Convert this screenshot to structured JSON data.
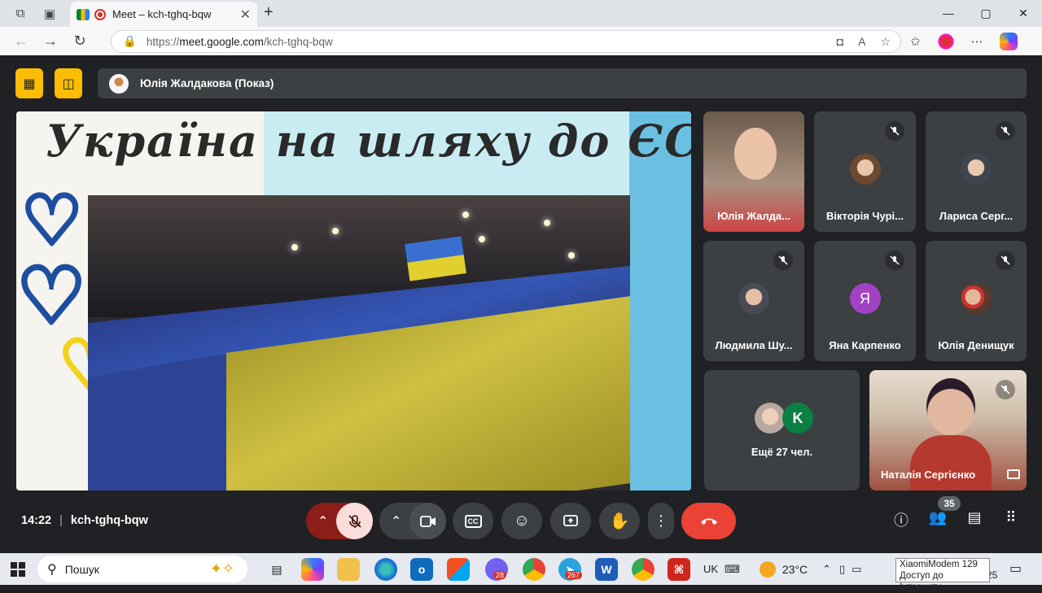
{
  "browser": {
    "tab_title": "Meet – kch-tghq-bqw",
    "new_tab_icon": "+",
    "url_prefix": "https://",
    "url_host": "meet.google.com",
    "url_path": "/kch-tghq-bqw",
    "window_controls": [
      "—",
      "▢",
      "✕"
    ]
  },
  "meet": {
    "presenter_bar": "Юлія Жалдакова (Показ)",
    "slide_title": "Україна на шляху до ЄС",
    "tiles": [
      {
        "name": "Юлія Жалда...",
        "muted": false,
        "video": true
      },
      {
        "name": "Вікторія Чурі...",
        "muted": true
      },
      {
        "name": "Лариса Серг...",
        "muted": true
      },
      {
        "name": "Людмила Шу...",
        "muted": true
      },
      {
        "name": "Яна Карпенко",
        "muted": true,
        "initial": "Я",
        "color": "#a142c4"
      },
      {
        "name": "Юлія Денищук",
        "muted": true
      },
      {
        "name": "Ещё 27 чел.",
        "initial": "K",
        "color": "#0b8043"
      },
      {
        "name": "Наталія Сергієнко",
        "muted": true,
        "video": true
      }
    ],
    "time": "14:22",
    "meeting_code": "kch-tghq-bqw",
    "participants_count": "35",
    "accent_red": "#ea4335",
    "yellow": "#fbbc04"
  },
  "taskbar": {
    "search_placeholder": "Пошук",
    "telegram_badge": "267",
    "viber_badge": "28",
    "word_label": "W",
    "keyboard_lang": "UK",
    "temperature": "23°C",
    "clock_tail": "25",
    "tooltip_line1": "XiaomiModem 129",
    "tooltip_line2": "Доступ до Інтернету"
  }
}
